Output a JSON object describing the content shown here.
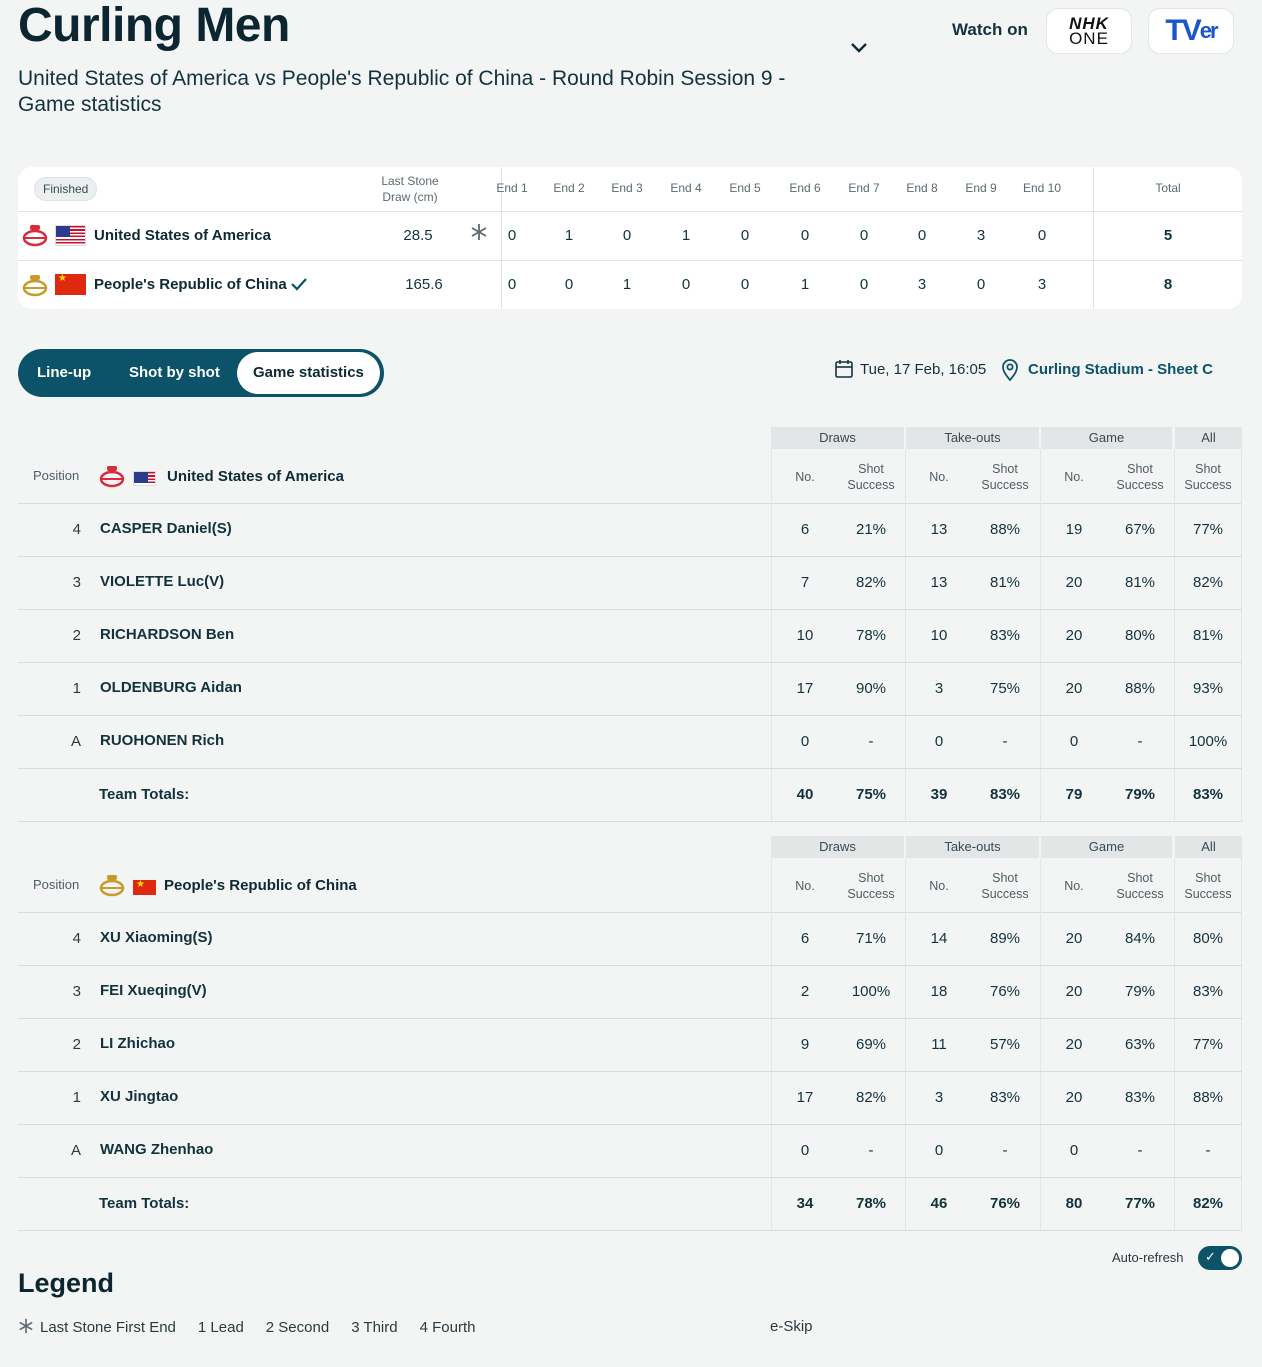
{
  "header": {
    "title": "Curling Men",
    "subtitle": "United States of America vs People's Republic of China - Round Robin Session 9 - Game statistics",
    "watch_on": "Watch on",
    "nhk_top": "NHK",
    "nhk_bottom": "ONE",
    "tver": "TV",
    "tver_suffix": "er"
  },
  "scoreboard": {
    "status": "Finished",
    "lsd_header_1": "Last Stone",
    "lsd_header_2": "Draw (cm)",
    "ends": [
      "End 1",
      "End 2",
      "End 3",
      "End 4",
      "End 5",
      "End 6",
      "End 7",
      "End 8",
      "End 9",
      "End 10"
    ],
    "total_header": "Total",
    "teams": [
      {
        "name": "United States of America",
        "lsd": "28.5",
        "ends": [
          "0",
          "1",
          "0",
          "1",
          "0",
          "0",
          "0",
          "0",
          "3",
          "0"
        ],
        "total": "5"
      },
      {
        "name": "People's Republic of China",
        "lsd": "165.6",
        "ends": [
          "0",
          "0",
          "1",
          "0",
          "0",
          "1",
          "0",
          "3",
          "0",
          "3"
        ],
        "total": "8"
      }
    ]
  },
  "tabs": {
    "lineup": "Line-up",
    "shot": "Shot by shot",
    "stats": "Game statistics"
  },
  "meta": {
    "date": "Tue, 17 Feb, 16:05",
    "venue": "Curling Stadium - Sheet C"
  },
  "stats_headers": {
    "position": "Position",
    "draws": "Draws",
    "takeouts": "Take-outs",
    "game": "Game",
    "all": "All",
    "no": "No.",
    "shot": "Shot",
    "success": "Success",
    "team_totals": "Team Totals:"
  },
  "stats": [
    {
      "team": "United States of America",
      "players": [
        {
          "pos": "4",
          "name": "CASPER Daniel(S)",
          "v": [
            "6",
            "21%",
            "13",
            "88%",
            "19",
            "67%",
            "77%"
          ]
        },
        {
          "pos": "3",
          "name": "VIOLETTE Luc(V)",
          "v": [
            "7",
            "82%",
            "13",
            "81%",
            "20",
            "81%",
            "82%"
          ]
        },
        {
          "pos": "2",
          "name": "RICHARDSON Ben",
          "v": [
            "10",
            "78%",
            "10",
            "83%",
            "20",
            "80%",
            "81%"
          ]
        },
        {
          "pos": "1",
          "name": "OLDENBURG Aidan",
          "v": [
            "17",
            "90%",
            "3",
            "75%",
            "20",
            "88%",
            "93%"
          ]
        },
        {
          "pos": "A",
          "name": "RUOHONEN Rich",
          "v": [
            "0",
            "-",
            "0",
            "-",
            "0",
            "-",
            "100%"
          ]
        }
      ],
      "totals": [
        "40",
        "75%",
        "39",
        "83%",
        "79",
        "79%",
        "83%"
      ]
    },
    {
      "team": "People's Republic of China",
      "players": [
        {
          "pos": "4",
          "name": "XU Xiaoming(S)",
          "v": [
            "6",
            "71%",
            "14",
            "89%",
            "20",
            "84%",
            "80%"
          ]
        },
        {
          "pos": "3",
          "name": "FEI Xueqing(V)",
          "v": [
            "2",
            "100%",
            "18",
            "76%",
            "20",
            "79%",
            "83%"
          ]
        },
        {
          "pos": "2",
          "name": "LI Zhichao",
          "v": [
            "9",
            "69%",
            "11",
            "57%",
            "20",
            "63%",
            "77%"
          ]
        },
        {
          "pos": "1",
          "name": "XU Jingtao",
          "v": [
            "17",
            "82%",
            "3",
            "83%",
            "20",
            "83%",
            "88%"
          ]
        },
        {
          "pos": "A",
          "name": "WANG Zhenhao",
          "v": [
            "0",
            "-",
            "0",
            "-",
            "0",
            "-",
            "-"
          ]
        }
      ],
      "totals": [
        "34",
        "78%",
        "46",
        "76%",
        "80",
        "77%",
        "82%"
      ]
    }
  ],
  "footer": {
    "auto_refresh": "Auto-refresh",
    "legend_title": "Legend",
    "legend": [
      "Last Stone First End",
      "1 Lead",
      "2 Second",
      "3 Third",
      "4 Fourth"
    ],
    "legend_tail": "e-Skip"
  },
  "colors": {
    "accent": "#0c5369",
    "usa_stone": "#d62c3c",
    "chn_stone": "#c89a2a"
  }
}
